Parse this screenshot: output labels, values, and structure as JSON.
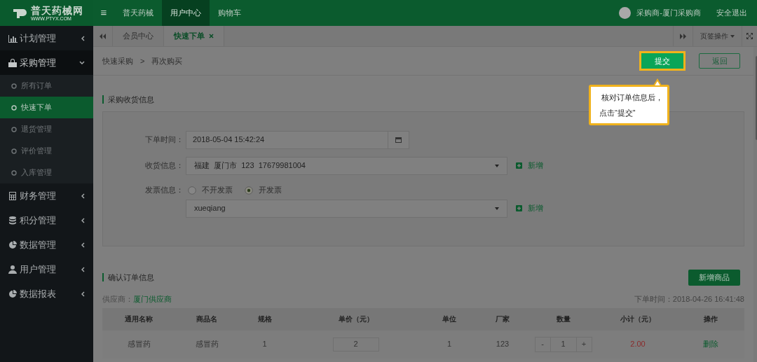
{
  "logo": {
    "name": "普天药械网",
    "url": "WWW.PTYX.COM"
  },
  "menu_icon": "≡",
  "top_nav": [
    {
      "label": "普天药械",
      "selected": false
    },
    {
      "label": "用户中心",
      "selected": true
    },
    {
      "label": "购物车",
      "selected": false
    }
  ],
  "user": {
    "name": "采购商-厦门采购商",
    "logout": "安全退出"
  },
  "sidebar": [
    {
      "label": "计划管理",
      "kind": "chart",
      "expanded": false
    },
    {
      "label": "采购管理",
      "kind": "bag",
      "expanded": true,
      "children": [
        {
          "label": "所有订单",
          "selected": false
        },
        {
          "label": "快速下单",
          "selected": true
        },
        {
          "label": "退货管理",
          "selected": false
        },
        {
          "label": "评价管理",
          "selected": false
        },
        {
          "label": "入库管理",
          "selected": false
        }
      ]
    },
    {
      "label": "财务管理",
      "kind": "calculator",
      "expanded": false
    },
    {
      "label": "积分管理",
      "kind": "database",
      "expanded": false
    },
    {
      "label": "数据管理",
      "kind": "pie",
      "expanded": false
    },
    {
      "label": "用户管理",
      "kind": "user",
      "expanded": false
    },
    {
      "label": "数据报表",
      "kind": "pie",
      "expanded": false
    }
  ],
  "page_tabs": [
    {
      "label": "会员中心",
      "selected": false,
      "closable": false
    },
    {
      "label": "快速下单",
      "selected": true,
      "closable": true
    }
  ],
  "tab_actions": "页签操作",
  "breadcrumb": [
    "快速采购",
    "再次购买"
  ],
  "breadcrumb_separator": ">",
  "actions": {
    "submit": "提交",
    "back": "返回"
  },
  "tooltip": [
    "核对订单信息后，",
    "点击“提交”"
  ],
  "shipping_section": {
    "title": "采购收货信息",
    "order_time": {
      "label": "下单时间：",
      "value": "2018-05-04 15:42:24"
    },
    "address": {
      "label": "收货信息：",
      "value": "福建  厦门市  123  17679981004",
      "add": "新增"
    },
    "invoice": {
      "label": "发票信息：",
      "options": [
        {
          "label": "不开发票",
          "selected": false
        },
        {
          "label": "开发票",
          "selected": true
        }
      ],
      "value": "xueqiang",
      "add": "新增"
    }
  },
  "order_section": {
    "title": "确认订单信息",
    "add_product": "新增商品",
    "supplier_label": "供应商：",
    "supplier": "厦门供应商",
    "order_time": "下单时间：2018-04-26 16:41:48",
    "columns": [
      "通用名称",
      "商品名",
      "规格",
      "单价（元）",
      "单位",
      "厂家",
      "数量",
      "小计（元）",
      "操作"
    ],
    "rows": [
      {
        "cells": [
          "感冒药",
          "感冒药",
          "1",
          "2",
          "1",
          "123",
          "1",
          "2.00",
          "删除"
        ],
        "decrement": "-",
        "increment": "+"
      }
    ]
  }
}
